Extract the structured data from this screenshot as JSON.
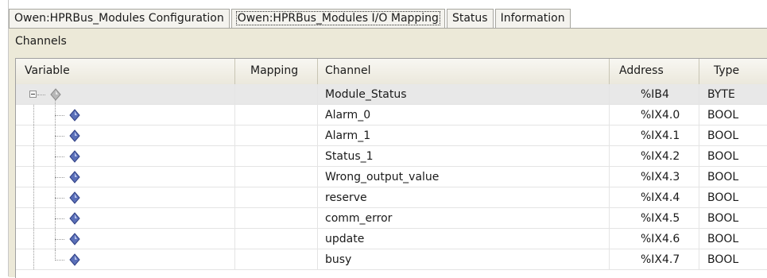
{
  "tabs": [
    {
      "label": "Owen:HPRBus_Modules Configuration",
      "active": false
    },
    {
      "label": "Owen:HPRBus_Modules I/O Mapping",
      "active": true
    },
    {
      "label": "Status",
      "active": false
    },
    {
      "label": "Information",
      "active": false
    }
  ],
  "group_title": "Channels",
  "columns": {
    "variable": "Variable",
    "mapping": "Mapping",
    "channel": "Channel",
    "address": "Address",
    "type": "Type"
  },
  "rows": [
    {
      "variable": "",
      "mapping": "",
      "channel": "Module_Status",
      "address": "%IB4",
      "type": "BYTE"
    },
    {
      "variable": "",
      "mapping": "",
      "channel": "Alarm_0",
      "address": "%IX4.0",
      "type": "BOOL"
    },
    {
      "variable": "",
      "mapping": "",
      "channel": "Alarm_1",
      "address": "%IX4.1",
      "type": "BOOL"
    },
    {
      "variable": "",
      "mapping": "",
      "channel": "Status_1",
      "address": "%IX4.2",
      "type": "BOOL"
    },
    {
      "variable": "",
      "mapping": "",
      "channel": "Wrong_output_value",
      "address": "%IX4.3",
      "type": "BOOL"
    },
    {
      "variable": "",
      "mapping": "",
      "channel": "reserve",
      "address": "%IX4.4",
      "type": "BOOL"
    },
    {
      "variable": "",
      "mapping": "",
      "channel": "comm_error",
      "address": "%IX4.5",
      "type": "BOOL"
    },
    {
      "variable": "",
      "mapping": "",
      "channel": "update",
      "address": "%IX4.6",
      "type": "BOOL"
    },
    {
      "variable": "",
      "mapping": "",
      "channel": "busy",
      "address": "%IX4.7",
      "type": "BOOL"
    }
  ],
  "icons": {
    "root_variable": "gray-diamond-variable-icon",
    "child_variable": "blue-diamond-variable-icon",
    "expander": "tree-collapse-minus-icon"
  }
}
